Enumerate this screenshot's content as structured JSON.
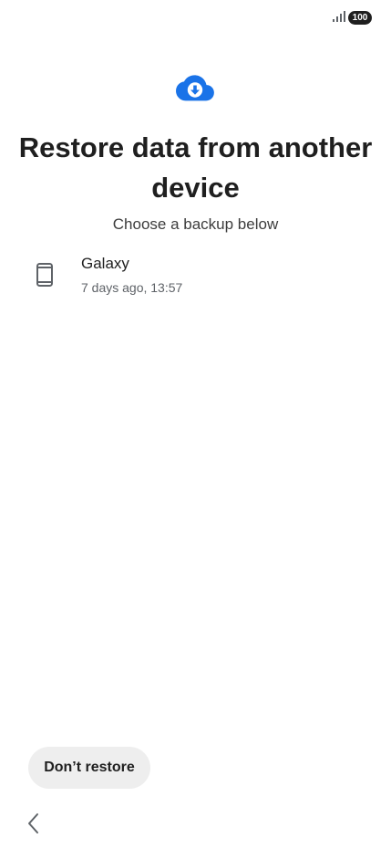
{
  "status_bar": {
    "battery_level": "100",
    "icons": [
      "signal-icon",
      "battery-icon"
    ]
  },
  "header": {
    "icon": "cloud-download-icon",
    "title": "Restore data from another device",
    "subtitle": "Choose a backup below"
  },
  "backups": [
    {
      "icon": "phone-icon",
      "name": "Galaxy",
      "meta": "7 days ago, 13:57"
    }
  ],
  "footer": {
    "dont_restore_label": "Don’t restore"
  },
  "navigation": {
    "back_icon": "chevron-left-icon"
  },
  "colors": {
    "accent": "#1a73e8",
    "text_primary": "#1f1f1f",
    "text_secondary": "#5f6368",
    "button_bg": "#eeeeee"
  }
}
